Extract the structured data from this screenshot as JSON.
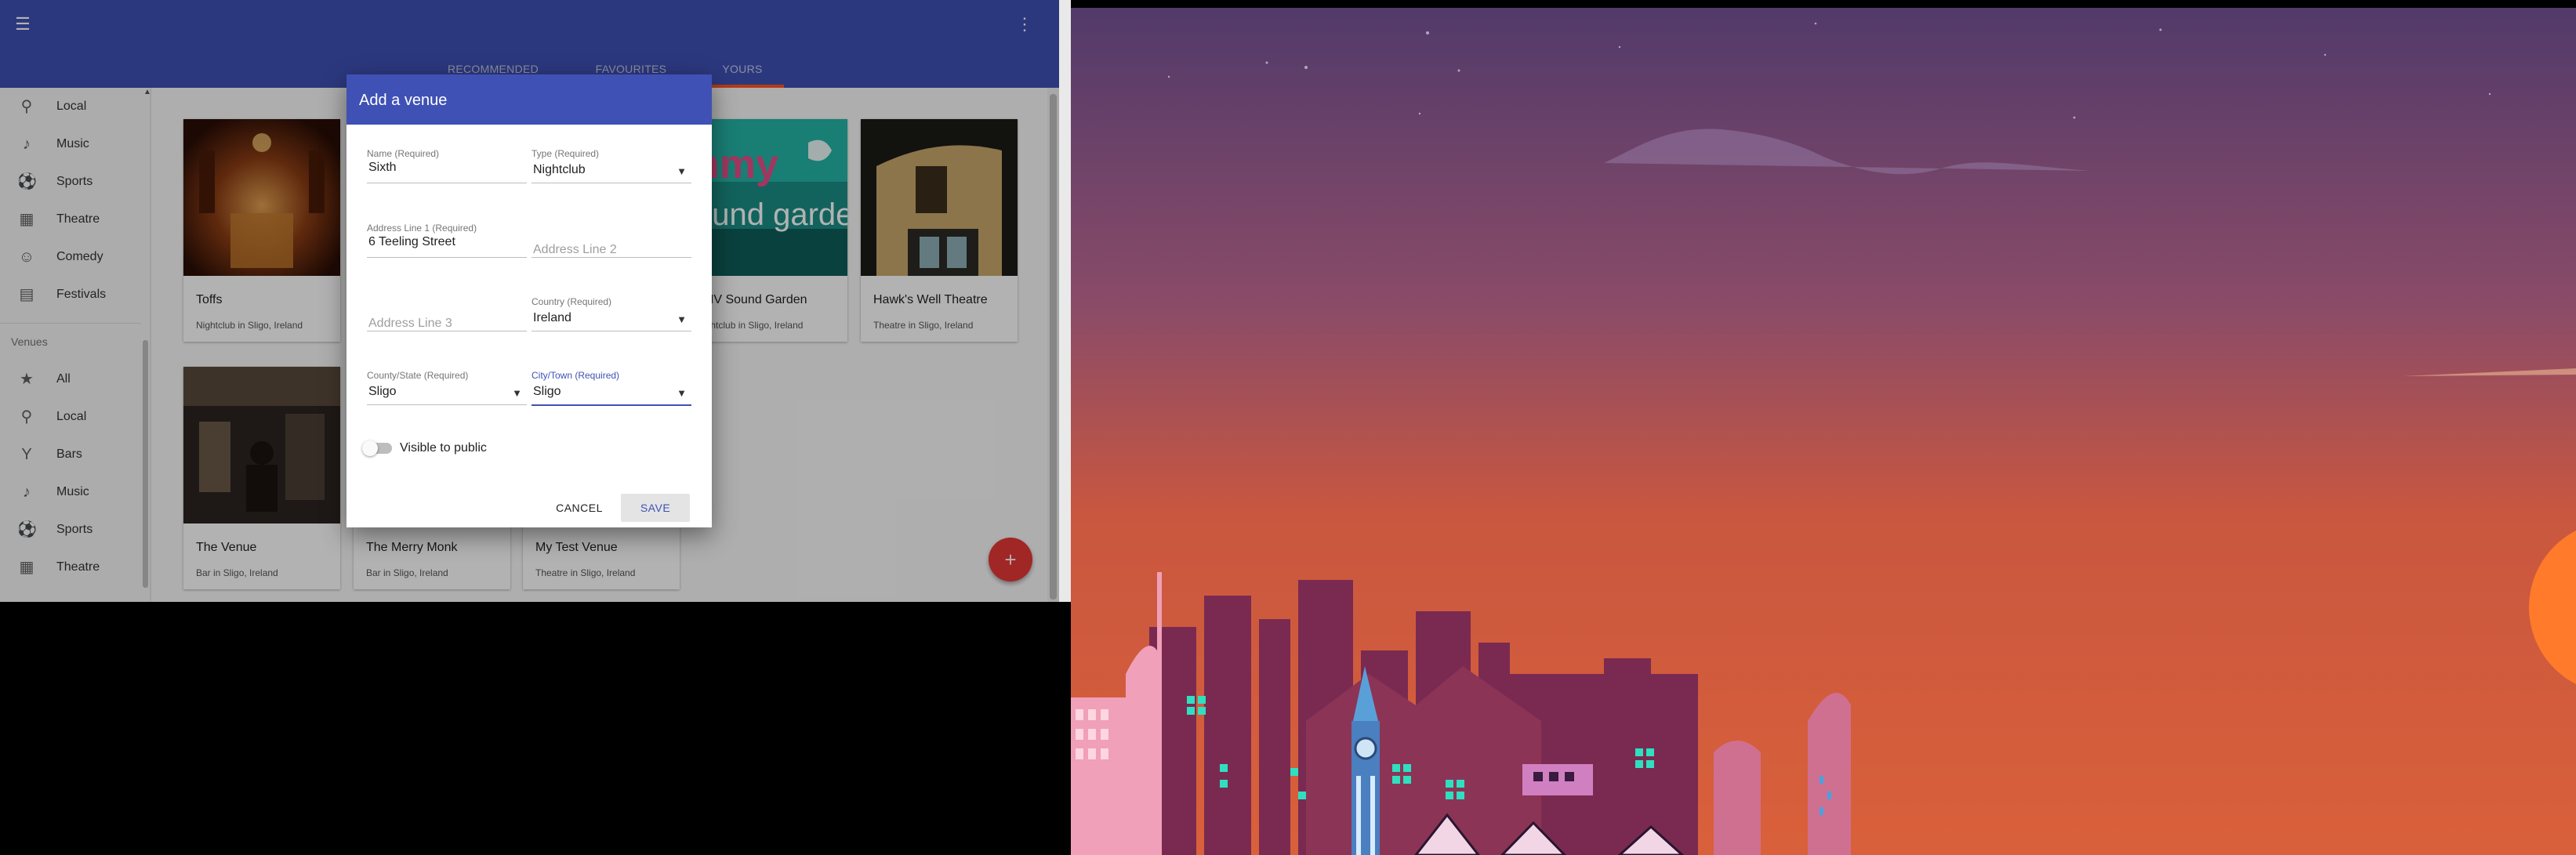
{
  "appbar": {
    "menu_icon": "menu-icon",
    "more_icon": "more-vert-icon",
    "tabs": [
      {
        "label": "RECOMMENDED"
      },
      {
        "label": "FAVOURITES"
      },
      {
        "label": "YOURS"
      }
    ],
    "active_tab": "YOURS",
    "color": "#3f51b5",
    "indicator_color": "#ff5722"
  },
  "sidebar": {
    "top_items": [
      {
        "label": "Local",
        "icon": "location-pin-icon"
      },
      {
        "label": "Music",
        "icon": "music-note-icon"
      },
      {
        "label": "Sports",
        "icon": "soccer-ball-icon"
      },
      {
        "label": "Theatre",
        "icon": "theatre-icon"
      },
      {
        "label": "Comedy",
        "icon": "smiley-icon"
      },
      {
        "label": "Festivals",
        "icon": "festival-icon"
      }
    ],
    "venues_header": "Venues",
    "venue_items": [
      {
        "label": "All",
        "icon": "star-icon"
      },
      {
        "label": "Local",
        "icon": "location-pin-icon"
      },
      {
        "label": "Bars",
        "icon": "cocktail-icon"
      },
      {
        "label": "Music",
        "icon": "music-note-icon"
      },
      {
        "label": "Sports",
        "icon": "soccer-ball-icon"
      },
      {
        "label": "Theatre",
        "icon": "theatre-icon"
      }
    ]
  },
  "cards": [
    {
      "title": "Toffs",
      "subtitle": "Nightclub in Sligo, Ireland"
    },
    {
      "title": "MV Sound Garden",
      "subtitle": "ightclub in Sligo, Ireland",
      "image_text": "nmy ound garden"
    },
    {
      "title": "Hawk's Well Theatre",
      "subtitle": "Theatre in Sligo, Ireland"
    },
    {
      "title": "The Venue",
      "subtitle": "Bar in Sligo, Ireland"
    },
    {
      "title": "The Merry Monk",
      "subtitle": "Bar in Sligo, Ireland"
    },
    {
      "title": "My Test Venue",
      "subtitle": "Theatre in Sligo, Ireland"
    }
  ],
  "fab": {
    "icon": "plus-icon",
    "glyph": "+",
    "color": "#e53935"
  },
  "dialog": {
    "title": "Add a venue",
    "fields": {
      "name": {
        "label": "Name (Required)",
        "value": "Sixth"
      },
      "type": {
        "label": "Type (Required)",
        "value": "Nightclub"
      },
      "address1": {
        "label": "Address Line 1 (Required)",
        "value": "6 Teeling Street"
      },
      "address2": {
        "placeholder": "Address Line 2"
      },
      "address3": {
        "placeholder": "Address Line 3"
      },
      "country": {
        "label": "Country (Required)",
        "value": "Ireland"
      },
      "county": {
        "label": "County/State (Required)",
        "value": "Sligo"
      },
      "city": {
        "label": "City/Town (Required)",
        "value": "Sligo"
      }
    },
    "visible_toggle": {
      "label": "Visible to public",
      "checked": false
    },
    "cancel_label": "CANCEL",
    "save_label": "SAVE"
  },
  "wallpaper": {
    "sky_top": "#5b3f6e",
    "sky_bottom": "#d4583a",
    "sun": "#ff7a2a"
  }
}
